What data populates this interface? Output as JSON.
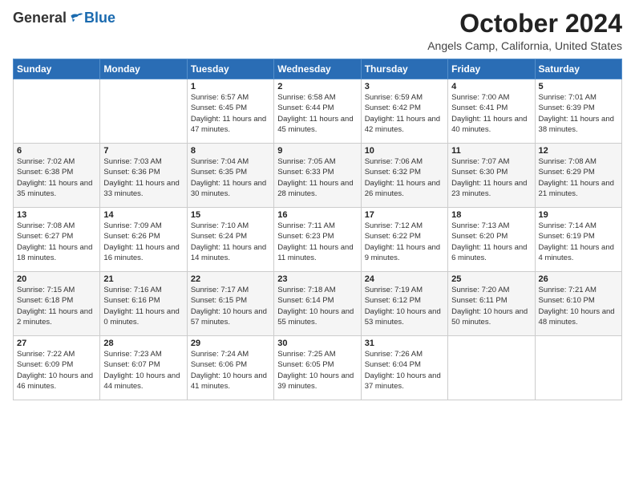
{
  "header": {
    "logo_general": "General",
    "logo_blue": "Blue",
    "month_title": "October 2024",
    "location": "Angels Camp, California, United States"
  },
  "days_of_week": [
    "Sunday",
    "Monday",
    "Tuesday",
    "Wednesday",
    "Thursday",
    "Friday",
    "Saturday"
  ],
  "weeks": [
    [
      {
        "day": "",
        "content": ""
      },
      {
        "day": "",
        "content": ""
      },
      {
        "day": "1",
        "content": "Sunrise: 6:57 AM\nSunset: 6:45 PM\nDaylight: 11 hours and 47 minutes."
      },
      {
        "day": "2",
        "content": "Sunrise: 6:58 AM\nSunset: 6:44 PM\nDaylight: 11 hours and 45 minutes."
      },
      {
        "day": "3",
        "content": "Sunrise: 6:59 AM\nSunset: 6:42 PM\nDaylight: 11 hours and 42 minutes."
      },
      {
        "day": "4",
        "content": "Sunrise: 7:00 AM\nSunset: 6:41 PM\nDaylight: 11 hours and 40 minutes."
      },
      {
        "day": "5",
        "content": "Sunrise: 7:01 AM\nSunset: 6:39 PM\nDaylight: 11 hours and 38 minutes."
      }
    ],
    [
      {
        "day": "6",
        "content": "Sunrise: 7:02 AM\nSunset: 6:38 PM\nDaylight: 11 hours and 35 minutes."
      },
      {
        "day": "7",
        "content": "Sunrise: 7:03 AM\nSunset: 6:36 PM\nDaylight: 11 hours and 33 minutes."
      },
      {
        "day": "8",
        "content": "Sunrise: 7:04 AM\nSunset: 6:35 PM\nDaylight: 11 hours and 30 minutes."
      },
      {
        "day": "9",
        "content": "Sunrise: 7:05 AM\nSunset: 6:33 PM\nDaylight: 11 hours and 28 minutes."
      },
      {
        "day": "10",
        "content": "Sunrise: 7:06 AM\nSunset: 6:32 PM\nDaylight: 11 hours and 26 minutes."
      },
      {
        "day": "11",
        "content": "Sunrise: 7:07 AM\nSunset: 6:30 PM\nDaylight: 11 hours and 23 minutes."
      },
      {
        "day": "12",
        "content": "Sunrise: 7:08 AM\nSunset: 6:29 PM\nDaylight: 11 hours and 21 minutes."
      }
    ],
    [
      {
        "day": "13",
        "content": "Sunrise: 7:08 AM\nSunset: 6:27 PM\nDaylight: 11 hours and 18 minutes."
      },
      {
        "day": "14",
        "content": "Sunrise: 7:09 AM\nSunset: 6:26 PM\nDaylight: 11 hours and 16 minutes."
      },
      {
        "day": "15",
        "content": "Sunrise: 7:10 AM\nSunset: 6:24 PM\nDaylight: 11 hours and 14 minutes."
      },
      {
        "day": "16",
        "content": "Sunrise: 7:11 AM\nSunset: 6:23 PM\nDaylight: 11 hours and 11 minutes."
      },
      {
        "day": "17",
        "content": "Sunrise: 7:12 AM\nSunset: 6:22 PM\nDaylight: 11 hours and 9 minutes."
      },
      {
        "day": "18",
        "content": "Sunrise: 7:13 AM\nSunset: 6:20 PM\nDaylight: 11 hours and 6 minutes."
      },
      {
        "day": "19",
        "content": "Sunrise: 7:14 AM\nSunset: 6:19 PM\nDaylight: 11 hours and 4 minutes."
      }
    ],
    [
      {
        "day": "20",
        "content": "Sunrise: 7:15 AM\nSunset: 6:18 PM\nDaylight: 11 hours and 2 minutes."
      },
      {
        "day": "21",
        "content": "Sunrise: 7:16 AM\nSunset: 6:16 PM\nDaylight: 11 hours and 0 minutes."
      },
      {
        "day": "22",
        "content": "Sunrise: 7:17 AM\nSunset: 6:15 PM\nDaylight: 10 hours and 57 minutes."
      },
      {
        "day": "23",
        "content": "Sunrise: 7:18 AM\nSunset: 6:14 PM\nDaylight: 10 hours and 55 minutes."
      },
      {
        "day": "24",
        "content": "Sunrise: 7:19 AM\nSunset: 6:12 PM\nDaylight: 10 hours and 53 minutes."
      },
      {
        "day": "25",
        "content": "Sunrise: 7:20 AM\nSunset: 6:11 PM\nDaylight: 10 hours and 50 minutes."
      },
      {
        "day": "26",
        "content": "Sunrise: 7:21 AM\nSunset: 6:10 PM\nDaylight: 10 hours and 48 minutes."
      }
    ],
    [
      {
        "day": "27",
        "content": "Sunrise: 7:22 AM\nSunset: 6:09 PM\nDaylight: 10 hours and 46 minutes."
      },
      {
        "day": "28",
        "content": "Sunrise: 7:23 AM\nSunset: 6:07 PM\nDaylight: 10 hours and 44 minutes."
      },
      {
        "day": "29",
        "content": "Sunrise: 7:24 AM\nSunset: 6:06 PM\nDaylight: 10 hours and 41 minutes."
      },
      {
        "day": "30",
        "content": "Sunrise: 7:25 AM\nSunset: 6:05 PM\nDaylight: 10 hours and 39 minutes."
      },
      {
        "day": "31",
        "content": "Sunrise: 7:26 AM\nSunset: 6:04 PM\nDaylight: 10 hours and 37 minutes."
      },
      {
        "day": "",
        "content": ""
      },
      {
        "day": "",
        "content": ""
      }
    ]
  ]
}
